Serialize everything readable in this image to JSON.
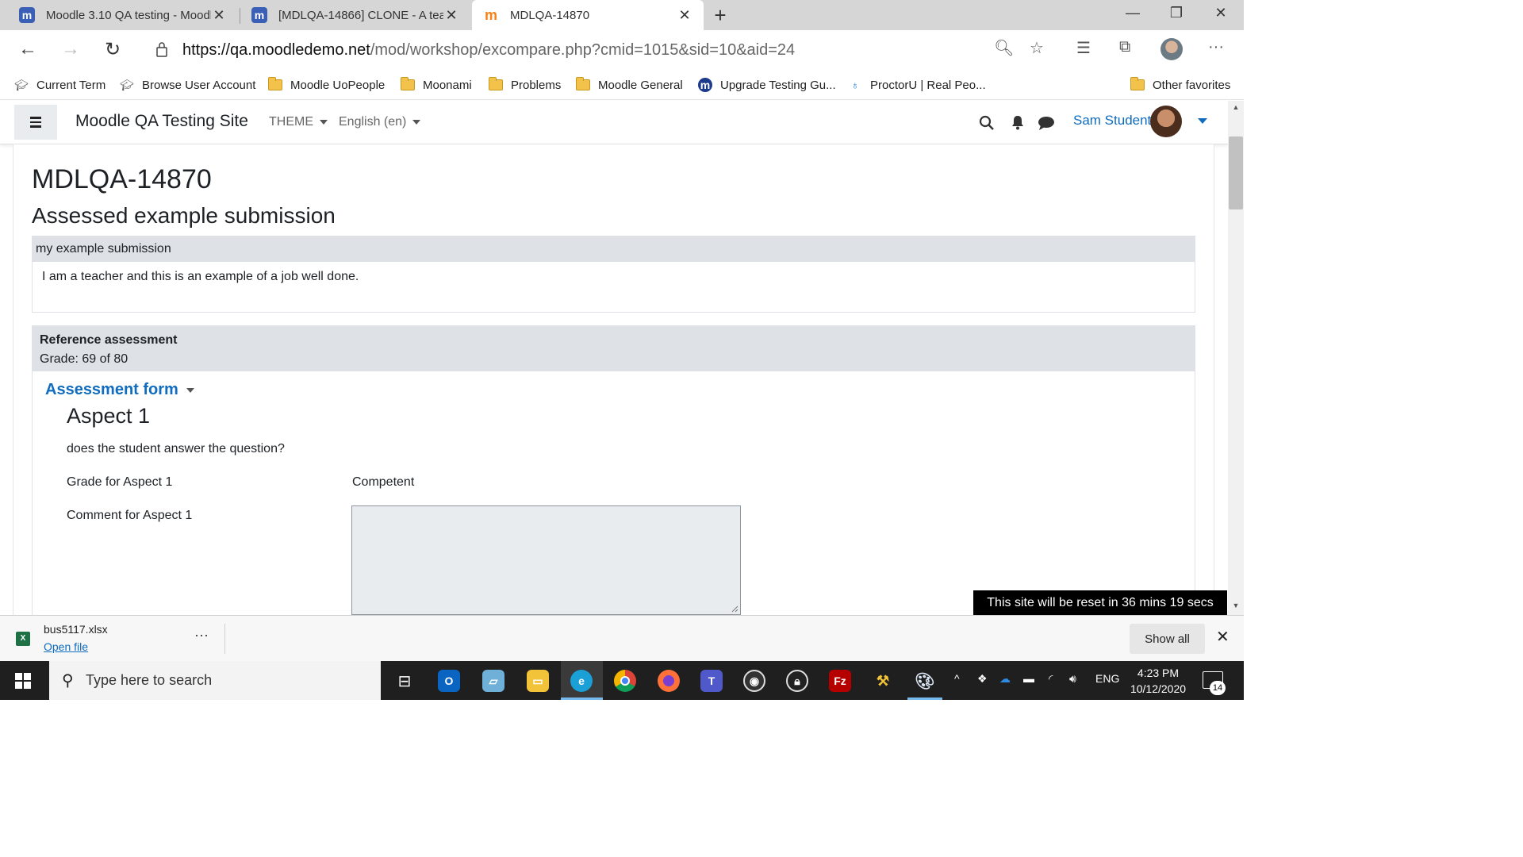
{
  "browser": {
    "tabs": [
      {
        "title": "Moodle 3.10 QA testing - Moodl",
        "icon": "moodle-m-icon"
      },
      {
        "title": "[MDLQA-14866] CLONE - A teac",
        "icon": "moodle-m-icon"
      },
      {
        "title": "MDLQA-14870",
        "icon": "moodle-hat-icon",
        "active": true
      }
    ],
    "url_host": "https://qa.moodledemo.net",
    "url_path": "/mod/workshop/excompare.php?cmid=1015&sid=10&aid=24",
    "favorites": [
      {
        "label": "Current Term",
        "icon": "mortarboard-icon"
      },
      {
        "label": "Browse User Account",
        "icon": "mortarboard-icon"
      },
      {
        "label": "Moodle UoPeople",
        "icon": "folder-icon"
      },
      {
        "label": "Moonami",
        "icon": "folder-icon"
      },
      {
        "label": "Problems",
        "icon": "folder-icon"
      },
      {
        "label": "Moodle General",
        "icon": "folder-icon"
      },
      {
        "label": "Upgrade Testing Gu...",
        "icon": "moodle-m-icon"
      },
      {
        "label": "ProctorU | Real Peo...",
        "icon": "owl-icon"
      }
    ],
    "other_favorites": "Other favorites"
  },
  "header": {
    "site_name": "Moodle QA Testing Site",
    "theme_menu": "THEME",
    "language_menu": "English (en)",
    "user_name": "Sam Student"
  },
  "main": {
    "title": "MDLQA-14870",
    "subtitle": "Assessed example submission",
    "submission": {
      "title": "my example submission",
      "content": "I am a teacher and this is an example of a job well done."
    },
    "reference": {
      "title": "Reference assessment",
      "grade": "Grade: 69 of 80"
    },
    "form_link": "Assessment form",
    "aspect": {
      "title": "Aspect 1",
      "description": "does the student answer the question?",
      "grade_label": "Grade for Aspect 1",
      "grade_value": "Competent",
      "comment_label": "Comment for Aspect 1"
    },
    "reset_notice": "This site will be reset in 36 mins 19 secs"
  },
  "download": {
    "filename": "bus5117.xlsx",
    "open_label": "Open file",
    "show_all": "Show all"
  },
  "taskbar": {
    "search_placeholder": "Type here to search",
    "language": "ENG",
    "time": "4:23 PM",
    "date": "10/12/2020",
    "notification_count": "14"
  },
  "colors": {
    "accent": "#0f6cbf",
    "moodle_orange": "#f98012",
    "section_bg": "#dee2e6"
  }
}
